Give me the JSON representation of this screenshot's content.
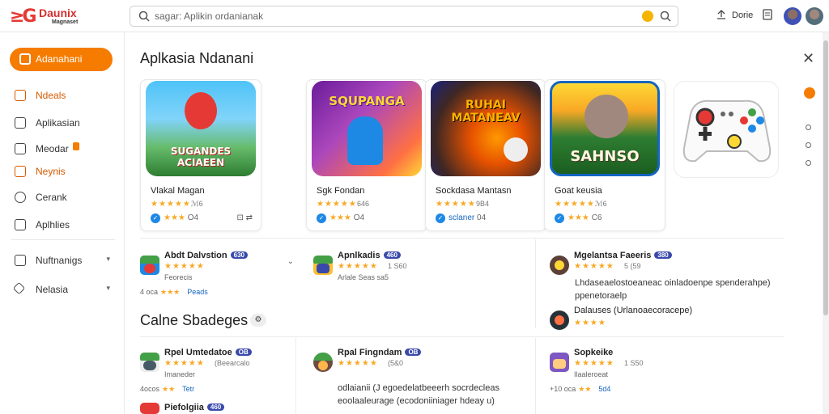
{
  "header": {
    "logo_text": "Daunix",
    "logo_sub": "Magnaset",
    "search_text": "sagar: Aplikin ordanianak",
    "right_label": "Dorie"
  },
  "sidebar": {
    "active": "Adanahani",
    "items": [
      {
        "label": "Ndeals",
        "highlight": true
      },
      {
        "label": "Aplikasian",
        "highlight": false
      },
      {
        "label": "Meodar",
        "highlight": false
      },
      {
        "label": "Neynis",
        "highlight": true
      },
      {
        "label": "Cerank",
        "highlight": false
      },
      {
        "label": "Aplhlies",
        "highlight": false
      },
      {
        "label": "Nuftnanigs",
        "highlight": false
      },
      {
        "label": "Nelasia",
        "highlight": false
      }
    ]
  },
  "main": {
    "title": "Aplkasia Ndanani",
    "cards": [
      {
        "thumb_text": "SUGANDES ACIAEEN",
        "name": "Vlakal Magan",
        "stars": "★★★★★",
        "rating": "ℳ6",
        "meta_stars": "★★★",
        "meta_count": "O4",
        "meta_right": "⊡ ⇄",
        "colors": [
          "#43a047",
          "#1e88e5",
          "#f4511e"
        ]
      },
      {
        "thumb_text": "SQUPANGA",
        "name": "Sgk Fondan",
        "stars": "★★★★★",
        "rating": "646",
        "meta_stars": "★★★",
        "meta_count": "O4",
        "meta_right": "",
        "colors": [
          "#8e24aa",
          "#fdd835",
          "#e53935"
        ]
      },
      {
        "thumb_text": "RUHAI MATANEAV",
        "name": "Sockdasa Mantasn",
        "stars": "★★★★★",
        "rating": "9B4",
        "meta_stars": "sclaner",
        "meta_count": "04",
        "meta_right": "",
        "colors": [
          "#3e2723",
          "#ff6f00",
          "#1a237e"
        ]
      },
      {
        "thumb_text": "SAHNSO",
        "name": "Goat keusia",
        "stars": "★★★★★",
        "rating": "ℳ6",
        "meta_stars": "★★★",
        "meta_count": "C6",
        "meta_right": "",
        "colors": [
          "#2e7d32",
          "#f9a825",
          "#6d4c41"
        ]
      }
    ],
    "featured_list": [
      {
        "title": "Abdt Dalvstion",
        "pill": "630",
        "stars": "★★★★★",
        "rating": "",
        "sub": "Feorecis",
        "foot_prefix": "4 oca",
        "foot_stars": "★★★",
        "foot_link": "Peads"
      },
      {
        "title": "Apnlkadis",
        "pill": "460",
        "stars": "★★★★★",
        "rating": "1 S60",
        "sub": "Arlale Seas sa5",
        "foot_prefix": "",
        "foot_stars": "",
        "foot_link": ""
      },
      {
        "title": "Mgelantsa Faeeris",
        "pill": "380",
        "stars": "★★★★★",
        "rating": "5 (59",
        "sub": "",
        "foot_prefix": "",
        "foot_stars": "",
        "foot_link": ""
      }
    ],
    "right_desc": "Lhdaseaelostoeaneac oinladoenpe spenderahpe) ppenetoraelp",
    "right_link_item": {
      "title": "Dalauses (Urlanoaecoracepe)",
      "stars": "★★★★"
    },
    "section_title": "Calne Sbadeges",
    "section_chip": "⚙",
    "bottom_list": [
      {
        "title": "Rpel Umtedatoe",
        "pill": "OB",
        "stars": "★★★★★",
        "rating": "(Beearcalo",
        "sub": "Imaneder",
        "foot_prefix": "4ocos",
        "foot_stars": "★★",
        "foot_link": "Tetr"
      },
      {
        "title": "Rpal Fingndam",
        "pill": "OB",
        "stars": "★★★★★",
        "rating": "(5&0",
        "sub": "",
        "foot_prefix": "",
        "foot_stars": "",
        "foot_link": ""
      },
      {
        "title": "Sopkeike",
        "pill": "",
        "stars": "★★★★★",
        "rating": "1 S50",
        "sub": "Ilaaleroeat",
        "foot_prefix": "+10 oca",
        "foot_stars": "★★",
        "foot_link": "5d4"
      },
      {
        "title": "Piefolgiia",
        "pill": "460",
        "stars": "",
        "rating": "",
        "sub": "",
        "foot_prefix": "",
        "foot_stars": "",
        "foot_link": ""
      }
    ],
    "bottom_desc": "odlaianii (J egoedelatbeeerh socrdecleas eoolaaleurage (ecodoniiniager hdeay u)"
  },
  "colors": {
    "accent": "#f57c00",
    "star": "#f9a825",
    "verified": "#1e88e5"
  }
}
